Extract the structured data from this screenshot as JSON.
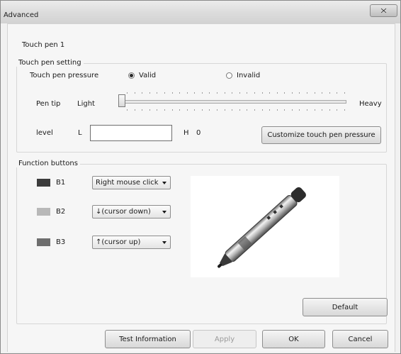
{
  "window": {
    "title": "Advanced"
  },
  "header": {
    "device_name": "Touch pen 1"
  },
  "touch_pen_setting": {
    "group_label": "Touch pen setting",
    "pressure_label": "Touch pen pressure",
    "valid_label": "Valid",
    "invalid_label": "Invalid",
    "selected": "Valid",
    "pen_tip_label": "Pen tip",
    "light_label": "Light",
    "heavy_label": "Heavy",
    "level_label": "level",
    "l_label": "L",
    "l_value": "",
    "h_label": "H",
    "h_value": "0",
    "customize_button": "Customize touch pen pressure"
  },
  "function_buttons": {
    "group_label": "Function buttons",
    "items": [
      {
        "label": "B1",
        "color": "#3c3c3c",
        "selected": "Right mouse click"
      },
      {
        "label": "B2",
        "color": "#b8b8b8",
        "selected": "↓(cursor down)"
      },
      {
        "label": "B3",
        "color": "#6e6e6e",
        "selected": "↑(cursor up)"
      }
    ],
    "default_button": "Default"
  },
  "footer": {
    "test_information_button": "Test Information",
    "apply_button": "Apply",
    "ok_button": "OK",
    "cancel_button": "Cancel"
  }
}
